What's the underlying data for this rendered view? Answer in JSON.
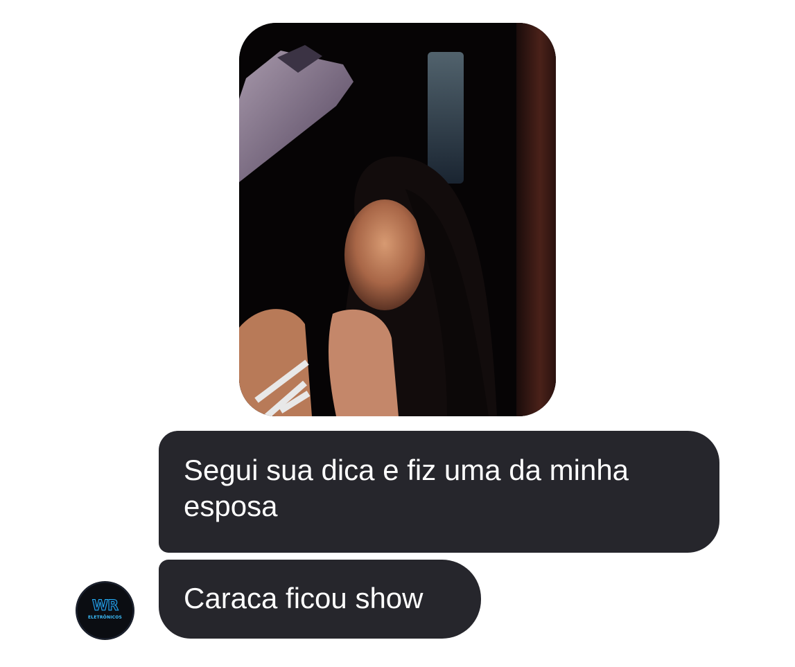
{
  "chat": {
    "messages": [
      {
        "type": "image",
        "alt_icon": "shared-photo-portrait"
      },
      {
        "type": "text",
        "text": "Segui sua dica e fiz uma da minha esposa"
      },
      {
        "type": "text",
        "text": "Caraca ficou show"
      }
    ],
    "avatar": {
      "brand": "WR",
      "subtitle": "ELETRÔNICOS",
      "icon": "apple-logo-icon"
    }
  },
  "colors": {
    "background": "#ffffff",
    "bubble": "#26262c",
    "bubble_text": "#ffffff",
    "avatar_accent": "#27b4ff"
  }
}
